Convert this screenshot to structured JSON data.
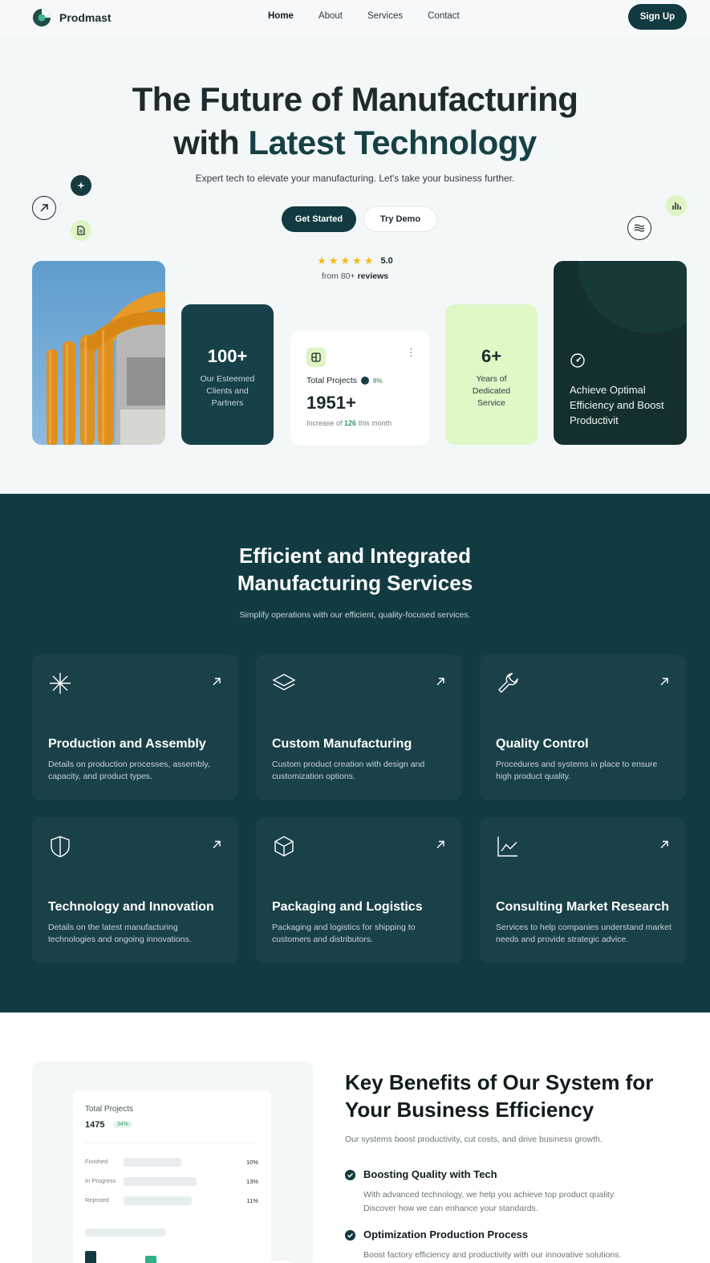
{
  "nav": {
    "brand": "Prodmast",
    "links": [
      "Home",
      "About",
      "Services",
      "Contact"
    ],
    "signup": "Sign Up"
  },
  "hero": {
    "title_line1": "The Future of Manufacturing",
    "title_line2_plain": "with ",
    "title_line2_accent": "Latest Technology",
    "subtitle": "Expert tech to elevate your manufacturing. Let's take your business further.",
    "primary_button": "Get Started",
    "secondary_button": "Try Demo",
    "rating": {
      "score": "5.0",
      "stars": 5,
      "from_text": "from 80+",
      "reviews": "reviews"
    }
  },
  "hero_cards": {
    "clients": {
      "value": "100+",
      "label": "Our Esteemed Clients and Partners"
    },
    "projects": {
      "label": "Total Projects",
      "percent": "8%",
      "value": "1951+",
      "note_prefix": "Increase of ",
      "note_highlight": "126",
      "note_suffix": " this month"
    },
    "years": {
      "value": "6+",
      "label": "Years of Dedicated Service"
    },
    "achieve": {
      "text": "Achieve Optimal Efficiency and Boost Productivit"
    }
  },
  "services": {
    "title_line1": "Efficient and Integrated",
    "title_line2": "Manufacturing Services",
    "subtitle": "Simplify operations with our efficient, quality-focused services.",
    "items": [
      {
        "name": "Production and Assembly",
        "desc": "Details on production processes, assembly, capacity, and product types.",
        "icon": "asterisk-icon"
      },
      {
        "name": "Custom Manufacturing",
        "desc": "Custom product creation with design and customization options.",
        "icon": "layers-icon"
      },
      {
        "name": "Quality Control",
        "desc": "Procedures and systems in place to ensure high product quality.",
        "icon": "wrench-icon"
      },
      {
        "name": "Technology and Innovation",
        "desc": "Details on the latest manufacturing technologies and ongoing innovations.",
        "icon": "shield-icon"
      },
      {
        "name": "Packaging and Logistics",
        "desc": "Packaging and logistics for shipping to customers and distributors.",
        "icon": "box-icon"
      },
      {
        "name": "Consulting Market Research",
        "desc": "Services to help companies understand market needs and provide strategic advice.",
        "icon": "chart-line-icon"
      }
    ]
  },
  "dashboard": {
    "title": "Total Projects",
    "value": "1475",
    "percent": "34%",
    "rows": [
      {
        "label": "Finished",
        "percent": "10%",
        "fill": 0.55
      },
      {
        "label": "In Progress",
        "percent": "13%",
        "fill": 0.7
      },
      {
        "label": "Rejected",
        "percent": "11%",
        "fill": 0.65
      }
    ]
  },
  "benefits": {
    "title_line1": "Key Benefits of Our System for",
    "title_line2": "Your Business Efficiency",
    "subtitle": "Our systems boost productivity, cut costs, and drive business growth.",
    "items": [
      {
        "head": "Boosting Quality with Tech",
        "body": "With advanced technology, we help you achieve top product quality. Discover how we can enhance your standards."
      },
      {
        "head": "Optimization Production Process",
        "body": "Boost factory efficiency and productivity with our innovative solutions."
      }
    ]
  }
}
